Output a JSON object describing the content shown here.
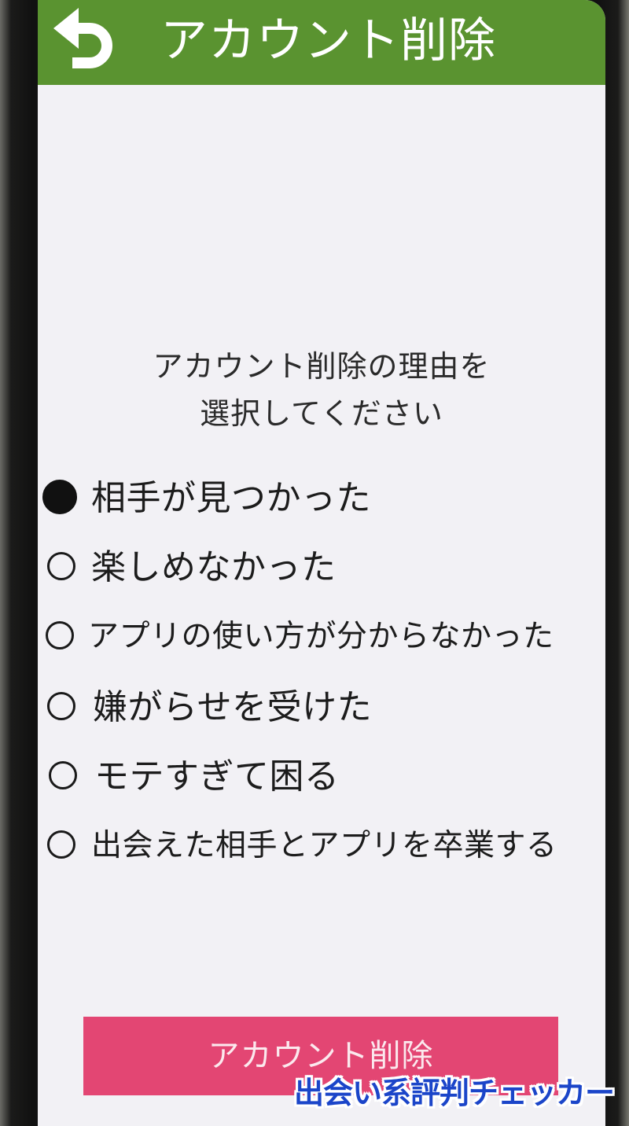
{
  "header": {
    "title": "アカウント削除",
    "back_icon": "undo-arrow-icon"
  },
  "prompt": {
    "line1": "アカウント削除の理由を",
    "line2": "選択してください"
  },
  "options": [
    {
      "label": "相手が見つかった",
      "selected": true
    },
    {
      "label": "楽しめなかった",
      "selected": false
    },
    {
      "label": "アプリの使い方が分からなかった",
      "selected": false
    },
    {
      "label": "嫌がらせを受けた",
      "selected": false
    },
    {
      "label": "モテすぎて困る",
      "selected": false
    },
    {
      "label": "出会えた相手とアプリを卒業する",
      "selected": false
    }
  ],
  "delete_button": {
    "label": "アカウント削除"
  },
  "watermark": {
    "text": "出会い系評判チェッカー"
  },
  "colors": {
    "header_bg": "#5a9330",
    "button_bg": "#e34673",
    "watermark": "#1b45c9"
  }
}
